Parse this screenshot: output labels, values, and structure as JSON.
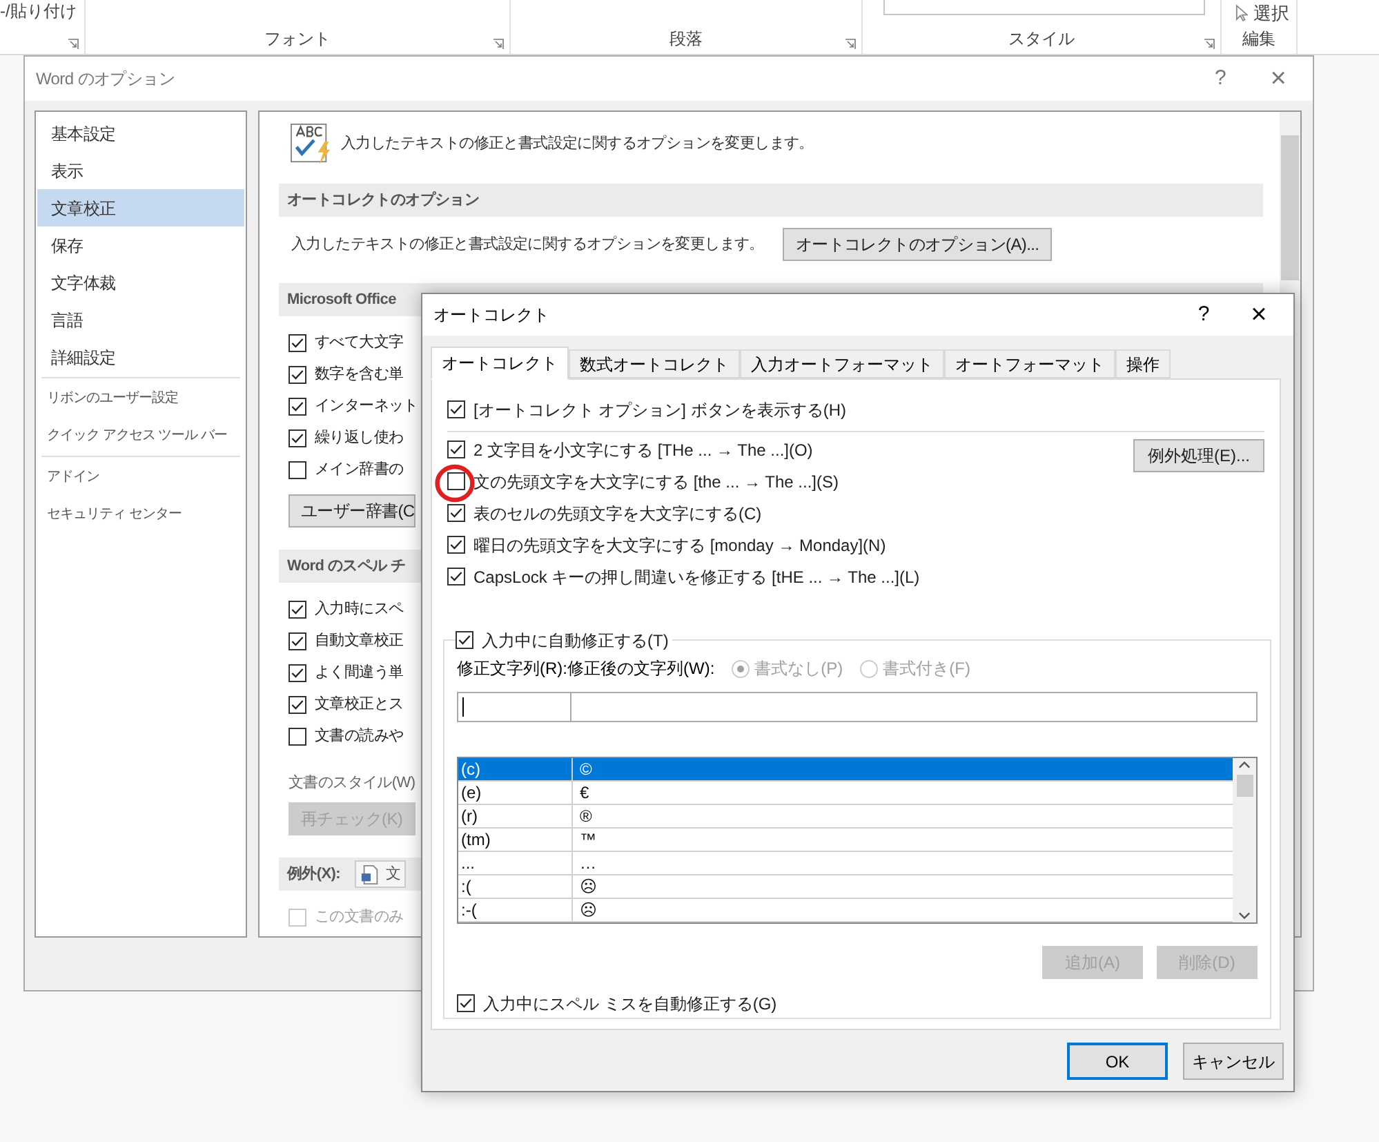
{
  "ribbon": {
    "clipboard_label": "-/貼り付け",
    "groups": [
      {
        "label": "フォント"
      },
      {
        "label": "段落"
      },
      {
        "label": "スタイル"
      },
      {
        "label": "編集"
      }
    ],
    "select_label": "選択"
  },
  "options_window": {
    "title": "Word のオプション",
    "help": "?",
    "close": "×",
    "sidebar": [
      [
        {
          "label": "基本設定",
          "selected": false
        },
        {
          "label": "表示",
          "selected": false
        },
        {
          "label": "文章校正",
          "selected": true
        },
        {
          "label": "保存",
          "selected": false
        },
        {
          "label": "文字体裁",
          "selected": false
        },
        {
          "label": "言語",
          "selected": false
        },
        {
          "label": "詳細設定",
          "selected": false
        }
      ],
      [
        {
          "label": "リボンのユーザー設定",
          "selected": false
        },
        {
          "label": "クイック アクセス ツール バー",
          "selected": false
        }
      ],
      [
        {
          "label": "アドイン",
          "selected": false
        },
        {
          "label": "セキュリティ センター",
          "selected": false
        }
      ]
    ],
    "header_text": "入力したテキストの修正と書式設定に関するオプションを変更します。",
    "sections": [
      {
        "title": "オートコレクトのオプション",
        "rows": [
          {
            "kind": "text_button",
            "text": "入力したテキストの修正と書式設定に関するオプションを変更します。",
            "button": "オートコレクトのオプション(A)..."
          }
        ]
      },
      {
        "title": "Microsoft Office",
        "rows": [
          {
            "kind": "check",
            "label": "すべて大文字",
            "checked": true
          },
          {
            "kind": "check",
            "label": "数字を含む単",
            "checked": true
          },
          {
            "kind": "check",
            "label": "インターネット",
            "checked": true
          },
          {
            "kind": "check",
            "label": "繰り返し使わ",
            "checked": true
          },
          {
            "kind": "check",
            "label": "メイン辞書の",
            "checked": false
          },
          {
            "kind": "button",
            "label": "ユーザー辞書(C",
            "disabled": false
          }
        ]
      },
      {
        "title": "Word のスペル チ",
        "rows": [
          {
            "kind": "check",
            "label": "入力時にスペ",
            "checked": true
          },
          {
            "kind": "check",
            "label": "自動文章校正",
            "checked": true
          },
          {
            "kind": "check",
            "label": "よく間違う単",
            "checked": true
          },
          {
            "kind": "check",
            "label": "文章校正とス",
            "checked": true
          },
          {
            "kind": "check",
            "label": "文書の読みや",
            "checked": false
          },
          {
            "kind": "label",
            "text": "文書のスタイル(W)"
          },
          {
            "kind": "button",
            "label": "再チェック(K)",
            "disabled": true
          }
        ]
      },
      {
        "title": "例外(X):",
        "dropdown": "文",
        "rows": [
          {
            "kind": "check",
            "label": "この文書のみ",
            "checked": false,
            "disabled": true
          }
        ]
      }
    ]
  },
  "autocorrect_dialog": {
    "title": "オートコレクト",
    "help": "?",
    "close": "×",
    "tabs": [
      {
        "label": "オートコレクト",
        "selected": true
      },
      {
        "label": "数式オートコレクト",
        "selected": false
      },
      {
        "label": "入力オートフォーマット",
        "selected": false
      },
      {
        "label": "オートフォーマット",
        "selected": false
      },
      {
        "label": "操作",
        "selected": false
      }
    ],
    "show_button_option": {
      "label": "[オートコレクト オプション] ボタンを表示する(H)",
      "checked": true
    },
    "options": [
      {
        "label": "2 文字目を小文字にする [THe ... → The ...](O)",
        "checked": true,
        "highlighted": false
      },
      {
        "label": "文の先頭文字を大文字にする [the ... → The ...](S)",
        "checked": false,
        "highlighted": true
      },
      {
        "label": "表のセルの先頭文字を大文字にする(C)",
        "checked": true,
        "highlighted": false
      },
      {
        "label": "曜日の先頭文字を大文字にする [monday →  Monday](N)",
        "checked": true,
        "highlighted": false
      },
      {
        "label": "CapsLock キーの押し間違いを修正する [tHE ... → The ...](L)",
        "checked": true,
        "highlighted": false
      }
    ],
    "exceptions_button": "例外処理(E)...",
    "replace_group": {
      "label": "入力中に自動修正する(T)",
      "checked": true
    },
    "replace_label": "修正文字列(R):",
    "with_label": "修正後の文字列(W):",
    "radios": [
      {
        "label": "書式なし(P)",
        "selected": true
      },
      {
        "label": "書式付き(F)",
        "selected": false
      }
    ],
    "entries": [
      {
        "from": "(c)",
        "to": "©",
        "selected": true
      },
      {
        "from": "(e)",
        "to": "€",
        "selected": false
      },
      {
        "from": "(r)",
        "to": "®",
        "selected": false
      },
      {
        "from": "(tm)",
        "to": "™",
        "selected": false
      },
      {
        "from": "...",
        "to": "…",
        "selected": false
      },
      {
        "from": ":(",
        "to": "☹",
        "selected": false
      },
      {
        "from": ":-(",
        "to": "☹",
        "selected": false
      }
    ],
    "add_button": "追加(A)",
    "delete_button": "削除(D)",
    "spelling_option": {
      "label": "入力中にスペル ミスを自動修正する(G)",
      "checked": true
    },
    "ok_button": "OK",
    "cancel_button": "キャンセル"
  }
}
